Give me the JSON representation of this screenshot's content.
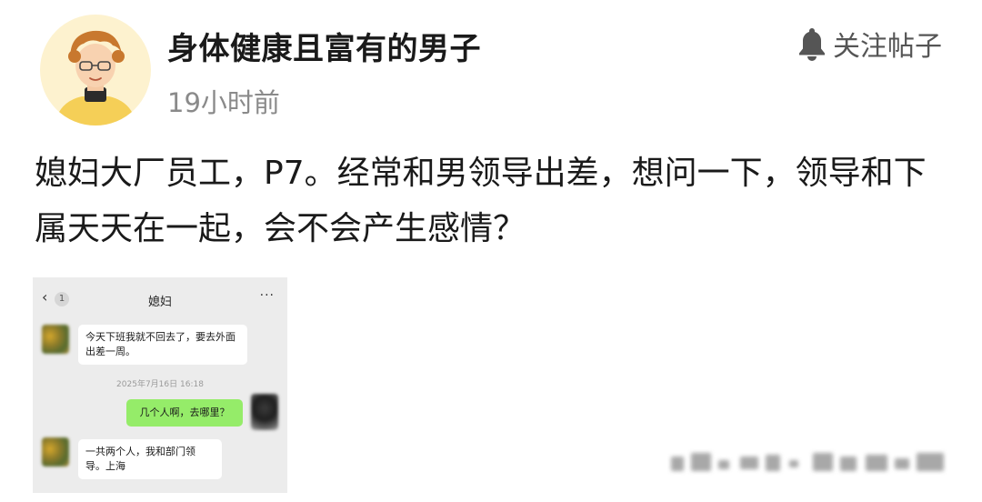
{
  "post": {
    "username": "身体健康且富有的男子",
    "time": "19小时前",
    "follow_label": "关注帖子",
    "text": "媳妇大厂员工，P7。经常和男领导出差，想问一下，领导和下属天天在一起，会不会产生感情？"
  },
  "chat": {
    "back_icon": "‹",
    "unread_count": "1",
    "contact_name": "媳妇",
    "more_icon": "···",
    "messages": [
      {
        "sender": "other",
        "text": "今天下班我就不回去了，要去外面出差一周。"
      },
      {
        "sender": "mine",
        "text": "几个人啊，去哪里？"
      },
      {
        "sender": "other",
        "text": "一共两个人，我和部门领导。上海"
      }
    ],
    "timestamp": "2025年7月16日 16:18"
  },
  "colors": {
    "follow_icon": "#555555",
    "time_text": "#8a8a8a",
    "chat_background": "#ececec",
    "my_bubble": "#95ec69",
    "their_bubble": "#ffffff"
  }
}
